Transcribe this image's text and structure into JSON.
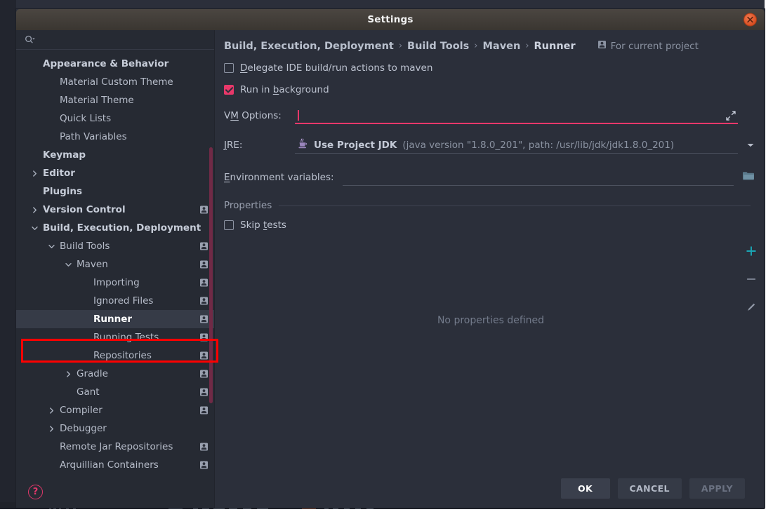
{
  "window": {
    "title": "Settings",
    "close_icon": "close-icon"
  },
  "sidebar": {
    "search": {
      "icon": "search-icon",
      "placeholder": "",
      "value": ""
    },
    "help_icon": "help-question-icon",
    "badge_icon": "for-current-project-icon",
    "items": [
      {
        "label": "Appearance & Behavior",
        "indent": 0,
        "bold": true,
        "arrow": "",
        "badge": false,
        "selected": false
      },
      {
        "label": "Material Custom Theme",
        "indent": 1,
        "bold": false,
        "arrow": "",
        "badge": false,
        "selected": false
      },
      {
        "label": "Material Theme",
        "indent": 1,
        "bold": false,
        "arrow": "",
        "badge": false,
        "selected": false
      },
      {
        "label": "Quick Lists",
        "indent": 1,
        "bold": false,
        "arrow": "",
        "badge": false,
        "selected": false
      },
      {
        "label": "Path Variables",
        "indent": 1,
        "bold": false,
        "arrow": "",
        "badge": false,
        "selected": false
      },
      {
        "label": "Keymap",
        "indent": 0,
        "bold": true,
        "arrow": "",
        "badge": false,
        "selected": false
      },
      {
        "label": "Editor",
        "indent": 0,
        "bold": true,
        "arrow": "right",
        "badge": false,
        "selected": false
      },
      {
        "label": "Plugins",
        "indent": 0,
        "bold": true,
        "arrow": "",
        "badge": false,
        "selected": false
      },
      {
        "label": "Version Control",
        "indent": 0,
        "bold": true,
        "arrow": "right",
        "badge": true,
        "selected": false
      },
      {
        "label": "Build, Execution, Deployment",
        "indent": 0,
        "bold": true,
        "arrow": "down",
        "badge": false,
        "selected": false
      },
      {
        "label": "Build Tools",
        "indent": 1,
        "bold": false,
        "arrow": "down",
        "badge": true,
        "selected": false
      },
      {
        "label": "Maven",
        "indent": 2,
        "bold": false,
        "arrow": "down",
        "badge": true,
        "selected": false
      },
      {
        "label": "Importing",
        "indent": 3,
        "bold": false,
        "arrow": "",
        "badge": true,
        "selected": false
      },
      {
        "label": "Ignored Files",
        "indent": 3,
        "bold": false,
        "arrow": "",
        "badge": true,
        "selected": false
      },
      {
        "label": "Runner",
        "indent": 3,
        "bold": true,
        "arrow": "",
        "badge": true,
        "selected": true
      },
      {
        "label": "Running Tests",
        "indent": 3,
        "bold": false,
        "arrow": "",
        "badge": true,
        "selected": false
      },
      {
        "label": "Repositories",
        "indent": 3,
        "bold": false,
        "arrow": "",
        "badge": true,
        "selected": false
      },
      {
        "label": "Gradle",
        "indent": 2,
        "bold": false,
        "arrow": "right",
        "badge": true,
        "selected": false
      },
      {
        "label": "Gant",
        "indent": 2,
        "bold": false,
        "arrow": "",
        "badge": true,
        "selected": false
      },
      {
        "label": "Compiler",
        "indent": 1,
        "bold": false,
        "arrow": "right",
        "badge": true,
        "selected": false
      },
      {
        "label": "Debugger",
        "indent": 1,
        "bold": false,
        "arrow": "right",
        "badge": false,
        "selected": false
      },
      {
        "label": "Remote Jar Repositories",
        "indent": 1,
        "bold": false,
        "arrow": "",
        "badge": true,
        "selected": false
      },
      {
        "label": "Arquillian Containers",
        "indent": 1,
        "bold": false,
        "arrow": "",
        "badge": true,
        "selected": false
      }
    ]
  },
  "content": {
    "breadcrumb": [
      {
        "label": "Build, Execution, Deployment"
      },
      {
        "label": "Build Tools"
      },
      {
        "label": "Maven"
      },
      {
        "label": "Runner"
      }
    ],
    "breadcrumb_separator": "›",
    "scope": {
      "icon": "for-current-project-icon",
      "label": "For current project"
    },
    "delegate_checkbox": {
      "label_prefix": "",
      "mnemonic": "D",
      "label_rest": "elegate IDE build/run actions to maven",
      "checked": false
    },
    "background_checkbox": {
      "label_prefix": "Run in ",
      "mnemonic": "b",
      "label_rest": "ackground",
      "checked": true
    },
    "vm_options": {
      "label_prefix": "V",
      "mnemonic": "M",
      "label_rest": " Options:",
      "value": "",
      "focused": true,
      "expand_icon": "expand-icon"
    },
    "jre": {
      "label_prefix": "",
      "mnemonic": "J",
      "label_rest": "RE:",
      "icon": "java-icon",
      "selected_main": "Use Project JDK",
      "selected_detail": "(java version \"1.8.0_201\", path: /usr/lib/jdk/jdk1.8.0_201)",
      "dropdown_icon": "chevron-down-icon"
    },
    "environment_variables": {
      "label_prefix": "",
      "mnemonic": "E",
      "label_rest": "nvironment variables:",
      "value": "",
      "browse_icon": "folder-icon"
    },
    "properties": {
      "section_title": "Properties",
      "skip_tests": {
        "label_prefix": "Skip ",
        "mnemonic": "t",
        "label_rest": "ests",
        "checked": false
      },
      "empty_message": "No properties defined",
      "tools": [
        {
          "name": "add-property-button",
          "icon": "plus-icon",
          "color": "#1aa6b5"
        },
        {
          "name": "remove-property-button",
          "icon": "minus-icon",
          "color": "#777e8d"
        },
        {
          "name": "edit-property-button",
          "icon": "pencil-icon",
          "color": "#8f96a4"
        }
      ]
    }
  },
  "footer": {
    "ok_label": "OK",
    "cancel_label": "CANCEL",
    "apply_label": "APPLY",
    "apply_enabled": false
  },
  "colors": {
    "accent_pink": "#e8386a",
    "dialog_bg": "#2b2f3a",
    "sidebar_bg": "#262a33",
    "titlebar_bg": "#3d3832",
    "close_button": "#d94f22",
    "annotation_red": "#fe0000",
    "scrollbar": "#702a46",
    "tool_add": "#1aa6b5"
  }
}
